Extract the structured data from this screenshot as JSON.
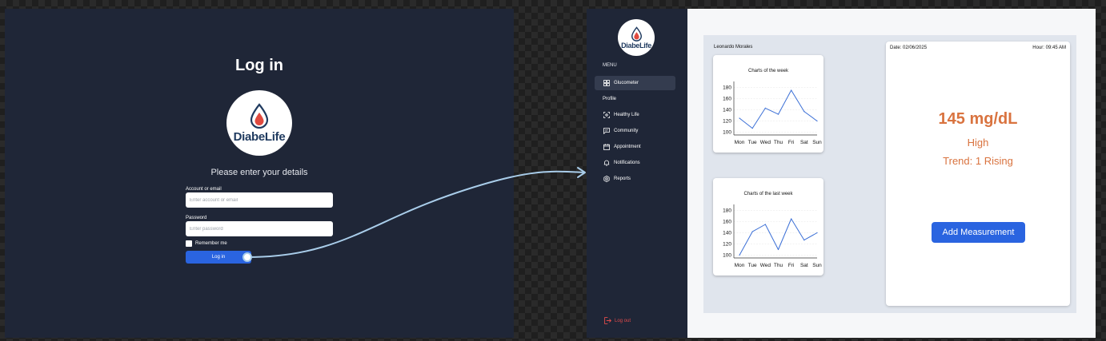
{
  "login": {
    "title": "Log in",
    "logo_text": "DiabeLife",
    "subtitle": "Please enter your details",
    "account_label": "Account or email",
    "account_placeholder": "Enter account or email",
    "password_label": "Password",
    "password_placeholder": "Enter password",
    "remember_label": "Remember me",
    "login_button": "Log in"
  },
  "sidebar": {
    "logo_text": "DiabeLife",
    "menu_label": "MENU",
    "items": [
      {
        "label": "Glucometer",
        "icon": "grid-icon",
        "active": true
      },
      {
        "label": "Profile",
        "icon": "",
        "active": false
      },
      {
        "label": "Healthy Life",
        "icon": "scan-icon",
        "active": false
      },
      {
        "label": "Community",
        "icon": "chat-icon",
        "active": false
      },
      {
        "label": "Appointment",
        "icon": "calendar-icon",
        "active": false
      },
      {
        "label": "Notifications",
        "icon": "bell-icon",
        "active": false
      },
      {
        "label": "Reports",
        "icon": "gear-icon",
        "active": false
      }
    ],
    "logout_label": "Log out"
  },
  "dashboard": {
    "user_name": "Leonardo Morales",
    "date": "Date: 02/06/2025",
    "hour": "Hour: 09:45 AM",
    "reading_value": "145 mg/dL",
    "reading_status": "High",
    "trend": "Trend: 1 Rising",
    "add_button": "Add Measurement"
  },
  "colors": {
    "accent": "#2a64e0",
    "reading": "#d9733f",
    "dark_bg": "#1f2637",
    "logout": "#e24b4b",
    "chart_line": "#3b6fd6",
    "drop": "#e04a3f"
  },
  "chart_data": [
    {
      "type": "line",
      "title": "Charts of the week",
      "categories": [
        "Mon",
        "Tue",
        "Wed",
        "Thu",
        "Fri",
        "Sat",
        "Sun"
      ],
      "values": [
        125,
        107,
        143,
        132,
        175,
        137,
        120
      ],
      "yticks": [
        100,
        120,
        140,
        160,
        180
      ],
      "ylim": [
        95,
        185
      ],
      "grid": true
    },
    {
      "type": "line",
      "title": "Charts of the last week",
      "categories": [
        "Mon",
        "Tue",
        "Wed",
        "Thu",
        "Fri",
        "Sat",
        "Sun"
      ],
      "values": [
        100,
        142,
        155,
        110,
        165,
        127,
        140
      ],
      "yticks": [
        100,
        120,
        140,
        160,
        180
      ],
      "ylim": [
        95,
        185
      ],
      "grid": true
    }
  ]
}
